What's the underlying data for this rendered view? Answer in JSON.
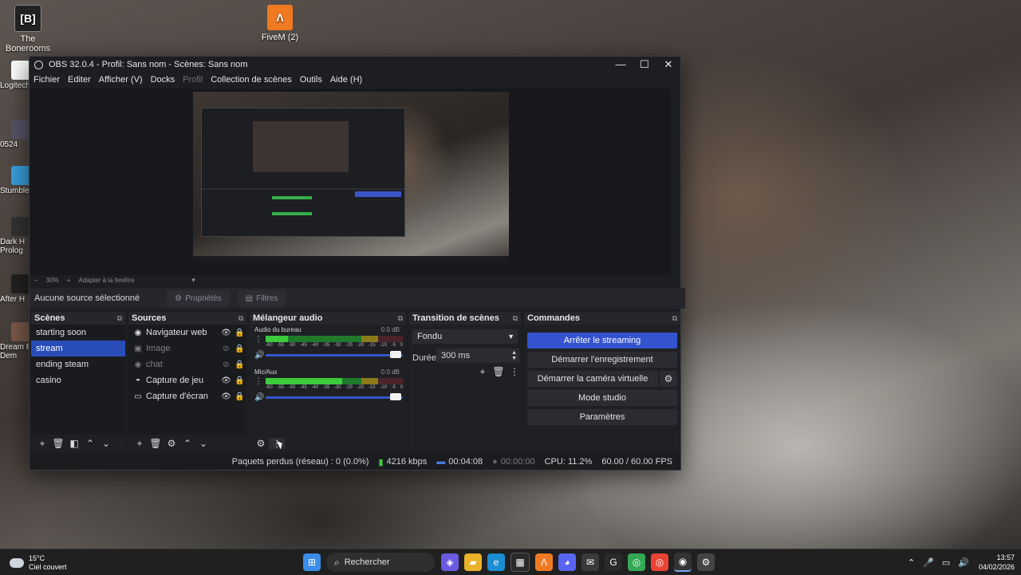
{
  "desktop": {
    "icons": [
      {
        "label": "The Bonerooms",
        "glyph": "[B]"
      },
      {
        "label": "FiveM (2)",
        "glyph": "Λ"
      }
    ],
    "left_labels": [
      "Logitech",
      "0524",
      "Stumble",
      "Dark H",
      "Prolog",
      "After H",
      "Dream Ea",
      "Dem"
    ]
  },
  "window": {
    "title": "OBS 32.0.4 - Profil: Sans nom - Scènes: Sans nom",
    "controls": {
      "minimize": "—",
      "maximize": "☐",
      "close": "✕"
    },
    "menu": [
      "Fichier",
      "Editer",
      "Afficher (V)",
      "Docks",
      "Profil",
      "Collection de scènes",
      "Outils",
      "Aide (H)"
    ],
    "zoom": {
      "minus": "−",
      "value": "30%",
      "plus": "+",
      "fit": "Adapter à la fenêtre",
      "caret": "▼"
    },
    "source_bar": {
      "text": "Aucune source sélectionné",
      "properties": "Propriétés",
      "filters": "Filtres"
    }
  },
  "scenes": {
    "title": "Scènes",
    "items": [
      "starting soon",
      "stream",
      "ending steam",
      "casino"
    ],
    "active": "stream"
  },
  "sources": {
    "title": "Sources",
    "items": [
      {
        "label": "Navigateur web",
        "icon": "globe-icon",
        "glyph": "◉"
      },
      {
        "label": "Image",
        "icon": "image-icon",
        "glyph": "▣"
      },
      {
        "label": "chat",
        "icon": "globe-icon",
        "glyph": "◉"
      },
      {
        "label": "Capture de jeu",
        "icon": "gamepad-icon",
        "glyph": "◓"
      },
      {
        "label": "Capture d'écran",
        "icon": "monitor-icon",
        "glyph": "▭"
      }
    ]
  },
  "mixer": {
    "title": "Mélangeur audio",
    "scale": [
      "-60",
      "-55",
      "-50",
      "-45",
      "-40",
      "-35",
      "-30",
      "-25",
      "-20",
      "-15",
      "-10",
      "-5",
      "0"
    ],
    "channels": [
      {
        "name": "Audio du bureau",
        "db": "0.0 dB",
        "level": 0.16
      },
      {
        "name": "Mic/Aux",
        "db": "0.0 dB",
        "level": 0.56
      }
    ]
  },
  "transitions": {
    "title": "Transition de scènes",
    "selected": "Fondu",
    "duration_label": "Durée",
    "duration_value": "300 ms"
  },
  "commands": {
    "title": "Commandes",
    "stop_streaming": "Arrêter le streaming",
    "start_recording": "Démarrer l'enregistrement",
    "virtual_camera": "Démarrer la caméra virtuelle",
    "studio_mode": "Mode studio",
    "settings": "Paramètres"
  },
  "status": {
    "dropped": "Paquets perdus (réseau) : 0 (0.0%)",
    "bitrate": "4216 kbps",
    "stream_time": "00:04:08",
    "rec_time": "00:00:00",
    "cpu": "CPU: 11.2%",
    "fps": "60.00 / 60.00 FPS"
  },
  "taskbar": {
    "weather_temp": "15°C",
    "weather_desc": "Ciel couvert",
    "search": "Rechercher",
    "time": "13:57",
    "date": "04/02/2026"
  },
  "colors": {
    "accent": "#3453cf",
    "meter_green": "#3ccb3c"
  }
}
